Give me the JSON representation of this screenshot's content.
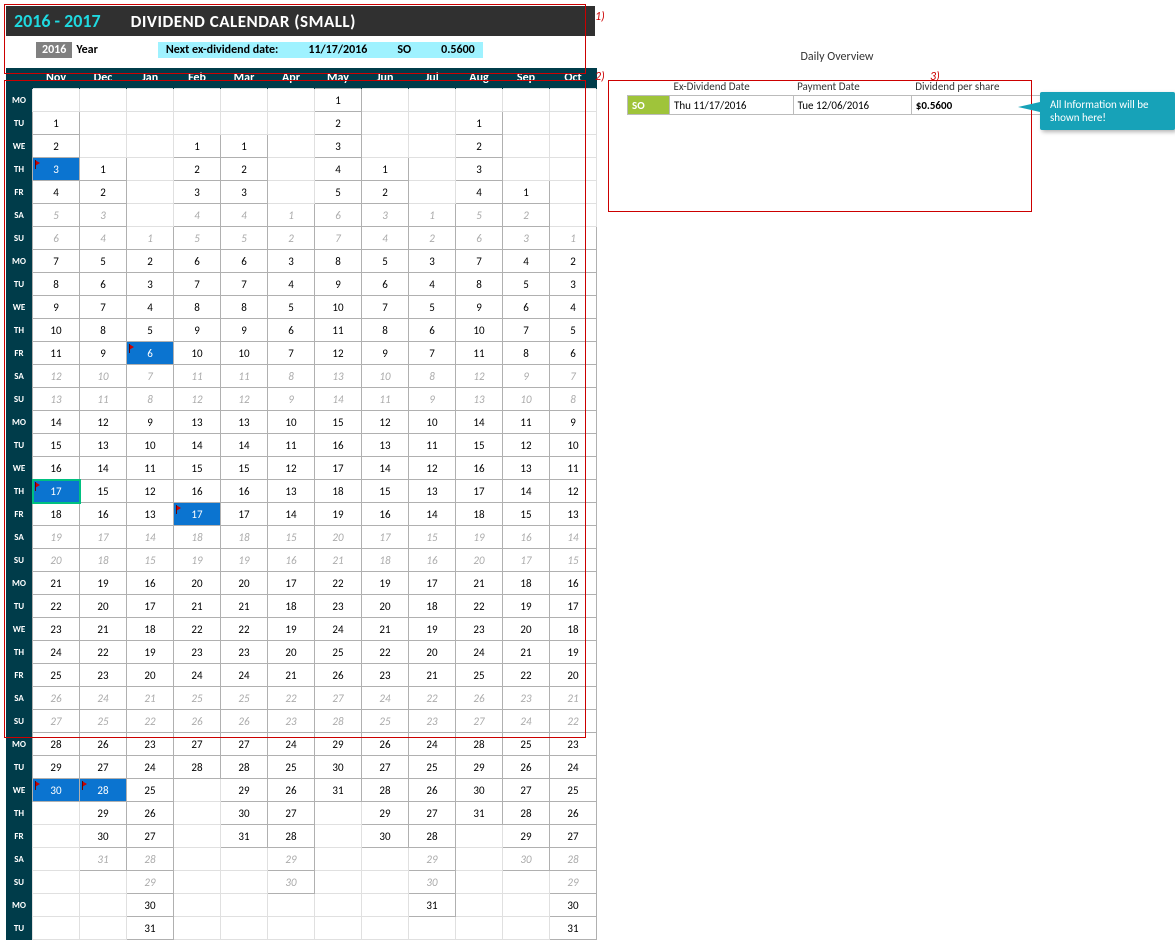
{
  "header": {
    "years": "2016 - 2017",
    "title": "DIVIDEND CALENDAR (SMALL)"
  },
  "info": {
    "year": "2016",
    "year_label": "Year",
    "next_label": "Next ex-dividend date:",
    "next_date": "11/17/2016",
    "next_ticker": "SO",
    "next_amount": "0.5600"
  },
  "annotations": {
    "a1": "1)",
    "a2": "2)",
    "a3": "3)"
  },
  "months": [
    "Nov",
    "Dec",
    "Jan",
    "Feb",
    "Mar",
    "Apr",
    "May",
    "Jun",
    "Jul",
    "Aug",
    "Sep",
    "Oct"
  ],
  "daynames": [
    "MO",
    "TU",
    "WE",
    "TH",
    "FR",
    "SA",
    "SU",
    "MO",
    "TU",
    "WE",
    "TH",
    "FR",
    "SA",
    "SU",
    "MO",
    "TU",
    "WE",
    "TH",
    "FR",
    "SA",
    "SU",
    "MO",
    "TU",
    "WE",
    "TH",
    "FR",
    "SA",
    "SU",
    "MO",
    "TU",
    "WE",
    "TH",
    "FR",
    "SA",
    "SU",
    "MO",
    "TU"
  ],
  "grid": [
    [
      "",
      "",
      "",
      "",
      "",
      "",
      "1",
      "",
      "",
      "",
      "",
      ""
    ],
    [
      "1",
      "",
      "",
      "",
      "",
      "",
      "2",
      "",
      "",
      "1",
      "",
      ""
    ],
    [
      "2",
      "",
      "",
      "1",
      "1",
      "",
      "3",
      "",
      "",
      "2",
      "",
      ""
    ],
    [
      "3m",
      "1",
      "",
      "2",
      "2",
      "",
      "4",
      "1",
      "",
      "3",
      "",
      ""
    ],
    [
      "4",
      "2",
      "",
      "3",
      "3",
      "",
      "5",
      "2",
      "",
      "4",
      "1",
      ""
    ],
    [
      "5w",
      "3w",
      "",
      "4w",
      "4w",
      "1w",
      "6w",
      "3w",
      "1w",
      "5w",
      "2w",
      ""
    ],
    [
      "6w",
      "4w",
      "1w",
      "5w",
      "5w",
      "2w",
      "7w",
      "4w",
      "2w",
      "6w",
      "3w",
      "1w"
    ],
    [
      "7",
      "5",
      "2",
      "6",
      "6",
      "3",
      "8",
      "5",
      "3",
      "7",
      "4",
      "2"
    ],
    [
      "8",
      "6",
      "3",
      "7",
      "7",
      "4",
      "9",
      "6",
      "4",
      "8",
      "5",
      "3"
    ],
    [
      "9",
      "7",
      "4",
      "8",
      "8",
      "5",
      "10",
      "7",
      "5",
      "9",
      "6",
      "4"
    ],
    [
      "10",
      "8",
      "5",
      "9",
      "9",
      "6",
      "11",
      "8",
      "6",
      "10",
      "7",
      "5"
    ],
    [
      "11",
      "9",
      "6m",
      "10",
      "10",
      "7",
      "12",
      "9",
      "7",
      "11",
      "8",
      "6"
    ],
    [
      "12w",
      "10w",
      "7w",
      "11w",
      "11w",
      "8w",
      "13w",
      "10w",
      "8w",
      "12w",
      "9w",
      "7w"
    ],
    [
      "13w",
      "11w",
      "8w",
      "12w",
      "12w",
      "9w",
      "14w",
      "11w",
      "9w",
      "13w",
      "10w",
      "8w"
    ],
    [
      "14",
      "12",
      "9",
      "13",
      "13",
      "10",
      "15",
      "12",
      "10",
      "14",
      "11",
      "9"
    ],
    [
      "15",
      "13",
      "10",
      "14",
      "14",
      "11",
      "16",
      "13",
      "11",
      "15",
      "12",
      "10"
    ],
    [
      "16",
      "14",
      "11",
      "15",
      "15",
      "12",
      "17",
      "14",
      "12",
      "16",
      "13",
      "11"
    ],
    [
      "17s",
      "15",
      "12",
      "16",
      "16",
      "13",
      "18",
      "15",
      "13",
      "17",
      "14",
      "12"
    ],
    [
      "18",
      "16",
      "13",
      "17m",
      "17",
      "14",
      "19",
      "16",
      "14",
      "18",
      "15",
      "13"
    ],
    [
      "19w",
      "17w",
      "14w",
      "18w",
      "18w",
      "15w",
      "20w",
      "17w",
      "15w",
      "19w",
      "16w",
      "14w"
    ],
    [
      "20w",
      "18w",
      "15w",
      "19w",
      "19w",
      "16w",
      "21w",
      "18w",
      "16w",
      "20w",
      "17w",
      "15w"
    ],
    [
      "21",
      "19",
      "16",
      "20",
      "20",
      "17",
      "22",
      "19",
      "17",
      "21",
      "18",
      "16"
    ],
    [
      "22",
      "20",
      "17",
      "21",
      "21",
      "18",
      "23",
      "20",
      "18",
      "22",
      "19",
      "17"
    ],
    [
      "23",
      "21",
      "18",
      "22",
      "22",
      "19",
      "24",
      "21",
      "19",
      "23",
      "20",
      "18"
    ],
    [
      "24",
      "22",
      "19",
      "23",
      "23",
      "20",
      "25",
      "22",
      "20",
      "24",
      "21",
      "19"
    ],
    [
      "25",
      "23",
      "20",
      "24",
      "24",
      "21",
      "26",
      "23",
      "21",
      "25",
      "22",
      "20"
    ],
    [
      "26w",
      "24w",
      "21w",
      "25w",
      "25w",
      "22w",
      "27w",
      "24w",
      "22w",
      "26w",
      "23w",
      "21w"
    ],
    [
      "27w",
      "25w",
      "22w",
      "26w",
      "26w",
      "23w",
      "28w",
      "25w",
      "23w",
      "27w",
      "24w",
      "22w"
    ],
    [
      "28",
      "26",
      "23",
      "27",
      "27",
      "24",
      "29",
      "26",
      "24",
      "28",
      "25",
      "23"
    ],
    [
      "29",
      "27",
      "24",
      "28",
      "28",
      "25",
      "30",
      "27",
      "25",
      "29",
      "26",
      "24"
    ],
    [
      "30m",
      "28m",
      "25",
      "",
      "29",
      "26",
      "31",
      "28",
      "26",
      "30",
      "27",
      "25"
    ],
    [
      "",
      "29",
      "26",
      "",
      "30",
      "27",
      "",
      "29",
      "27",
      "31",
      "28",
      "26"
    ],
    [
      "",
      "30",
      "27",
      "",
      "31",
      "28",
      "",
      "30",
      "28",
      "",
      "29",
      "27"
    ],
    [
      "",
      "31w",
      "28w",
      "",
      "",
      "29w",
      "",
      "",
      "29w",
      "",
      "30w",
      "28w"
    ],
    [
      "",
      "",
      "29w",
      "",
      "",
      "30w",
      "",
      "",
      "30w",
      "",
      "",
      "29w"
    ],
    [
      "",
      "",
      "30",
      "",
      "",
      "",
      "",
      "",
      "31",
      "",
      "",
      "30"
    ],
    [
      "",
      "",
      "31",
      "",
      "",
      "",
      "",
      "",
      "",
      "",
      "",
      "31"
    ]
  ],
  "overview": {
    "title": "Daily Overview",
    "cols": {
      "c1": "Ex-Dividend Date",
      "c2": "Payment Date",
      "c3": "Dividend per share"
    },
    "row": {
      "ticker": "SO",
      "exdate": "Thu  11/17/2016",
      "paydate": "Tue  12/06/2016",
      "amount": "$0.5600"
    }
  },
  "callout": "All Information will be shown here!"
}
